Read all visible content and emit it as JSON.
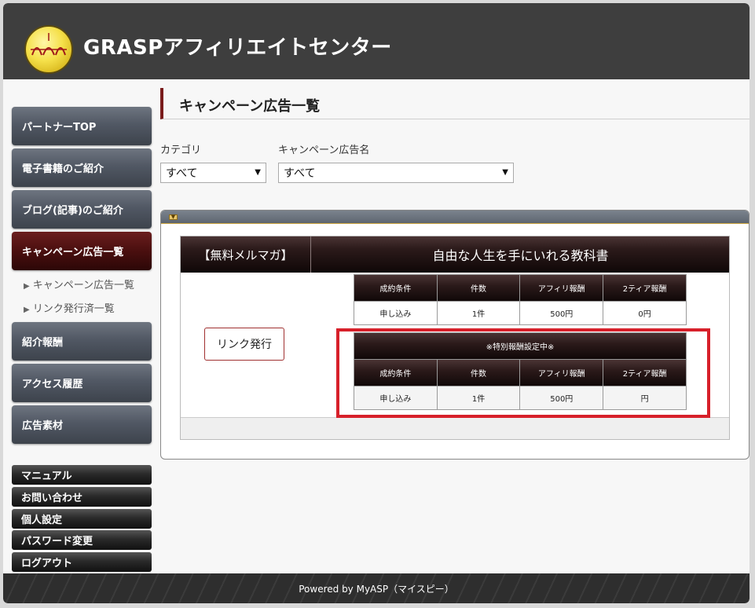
{
  "header": {
    "title": "GRASPアフィリエイトセンター"
  },
  "sidebar": {
    "items": [
      {
        "label": "パートナーTOP"
      },
      {
        "label": "電子書籍のご紹介"
      },
      {
        "label": "ブログ(記事)のご紹介"
      },
      {
        "label": "キャンペーン広告一覧"
      },
      {
        "label": "紹介報酬"
      },
      {
        "label": "アクセス履歴"
      },
      {
        "label": "広告素材"
      }
    ],
    "subitems": [
      {
        "label": "キャンペーン広告一覧"
      },
      {
        "label": "リンク発行済一覧"
      }
    ],
    "utilities": [
      {
        "label": "マニュアル"
      },
      {
        "label": "お問い合わせ"
      },
      {
        "label": "個人設定"
      },
      {
        "label": "パスワード変更"
      },
      {
        "label": "ログアウト"
      }
    ]
  },
  "main": {
    "page_title": "キャンペーン広告一覧",
    "filters": {
      "category_label": "カテゴリ",
      "category_value": "すべて",
      "campaign_label": "キャンペーン広告名",
      "campaign_value": "すべて"
    },
    "campaign": {
      "category": "【無料メルマガ】",
      "title": "自由な人生を手にいれる教科書",
      "link_button": "リンク発行",
      "reward_table": {
        "headers": [
          "成約条件",
          "件数",
          "アフィリ報酬",
          "2ティア報酬"
        ],
        "row": [
          "申し込み",
          "1件",
          "500円",
          "0円"
        ]
      },
      "special_table": {
        "notice": "※特別報酬設定中※",
        "headers": [
          "成約条件",
          "件数",
          "アフィリ報酬",
          "2ティア報酬"
        ],
        "row": [
          "申し込み",
          "1件",
          "500円",
          "円"
        ]
      }
    }
  },
  "footer": {
    "text": "Powered by MyASP（マイスピー）"
  },
  "colors": {
    "header_bg": "#3e3e3e",
    "active_nav": "#4a0f0f",
    "highlight_border": "#d7202a"
  }
}
